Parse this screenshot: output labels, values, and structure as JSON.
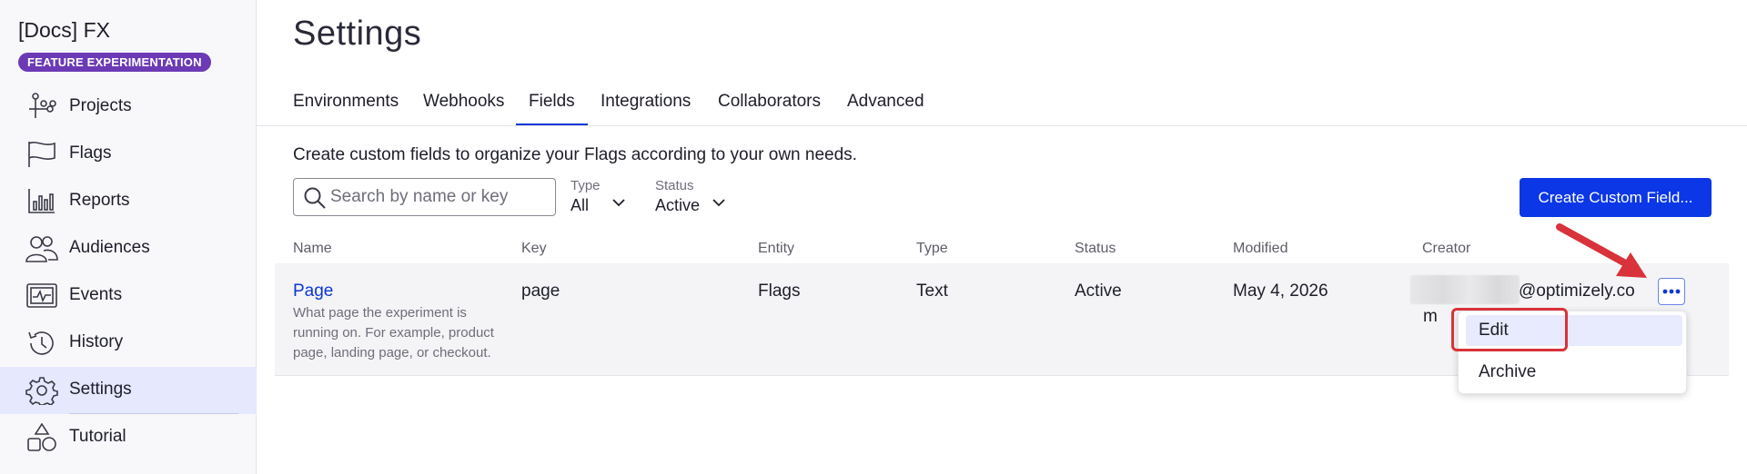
{
  "app": {
    "name": "[Docs] FX",
    "badge": "FEATURE EXPERIMENTATION"
  },
  "sidebar": {
    "items": [
      {
        "label": "Projects",
        "icon": "projects-icon"
      },
      {
        "label": "Flags",
        "icon": "flag-icon"
      },
      {
        "label": "Reports",
        "icon": "reports-icon"
      },
      {
        "label": "Audiences",
        "icon": "audiences-icon"
      },
      {
        "label": "Events",
        "icon": "events-icon"
      },
      {
        "label": "History",
        "icon": "history-icon"
      },
      {
        "label": "Settings",
        "icon": "settings-icon",
        "active": true
      },
      {
        "label": "Tutorial",
        "icon": "tutorial-icon"
      }
    ]
  },
  "page": {
    "title": "Settings",
    "description": "Create custom fields to organize your Flags according to your own needs."
  },
  "tabs": [
    {
      "label": "Environments"
    },
    {
      "label": "Webhooks"
    },
    {
      "label": "Fields",
      "active": true
    },
    {
      "label": "Integrations"
    },
    {
      "label": "Collaborators"
    },
    {
      "label": "Advanced"
    }
  ],
  "toolbar": {
    "search_placeholder": "Search by name or key",
    "type_label": "Type",
    "type_value": "All",
    "status_label": "Status",
    "status_value": "Active",
    "create_label": "Create Custom Field..."
  },
  "table": {
    "headers": [
      "Name",
      "Key",
      "Entity",
      "Type",
      "Status",
      "Modified",
      "Creator"
    ],
    "rows": [
      {
        "name": "Page",
        "description": "What page the experiment is running on. For example, product page, landing page, or checkout.",
        "key": "page",
        "entity": "Flags",
        "type": "Text",
        "status": "Active",
        "modified": "May 4, 2026",
        "creator_email": "@optimizely.co",
        "creator_wrap": "m"
      }
    ]
  },
  "menu": {
    "items": [
      {
        "label": "Edit"
      },
      {
        "label": "Archive"
      }
    ]
  },
  "colors": {
    "accent": "#0b37e6",
    "badge": "#6c3ab5",
    "annotation": "#d8323a"
  }
}
